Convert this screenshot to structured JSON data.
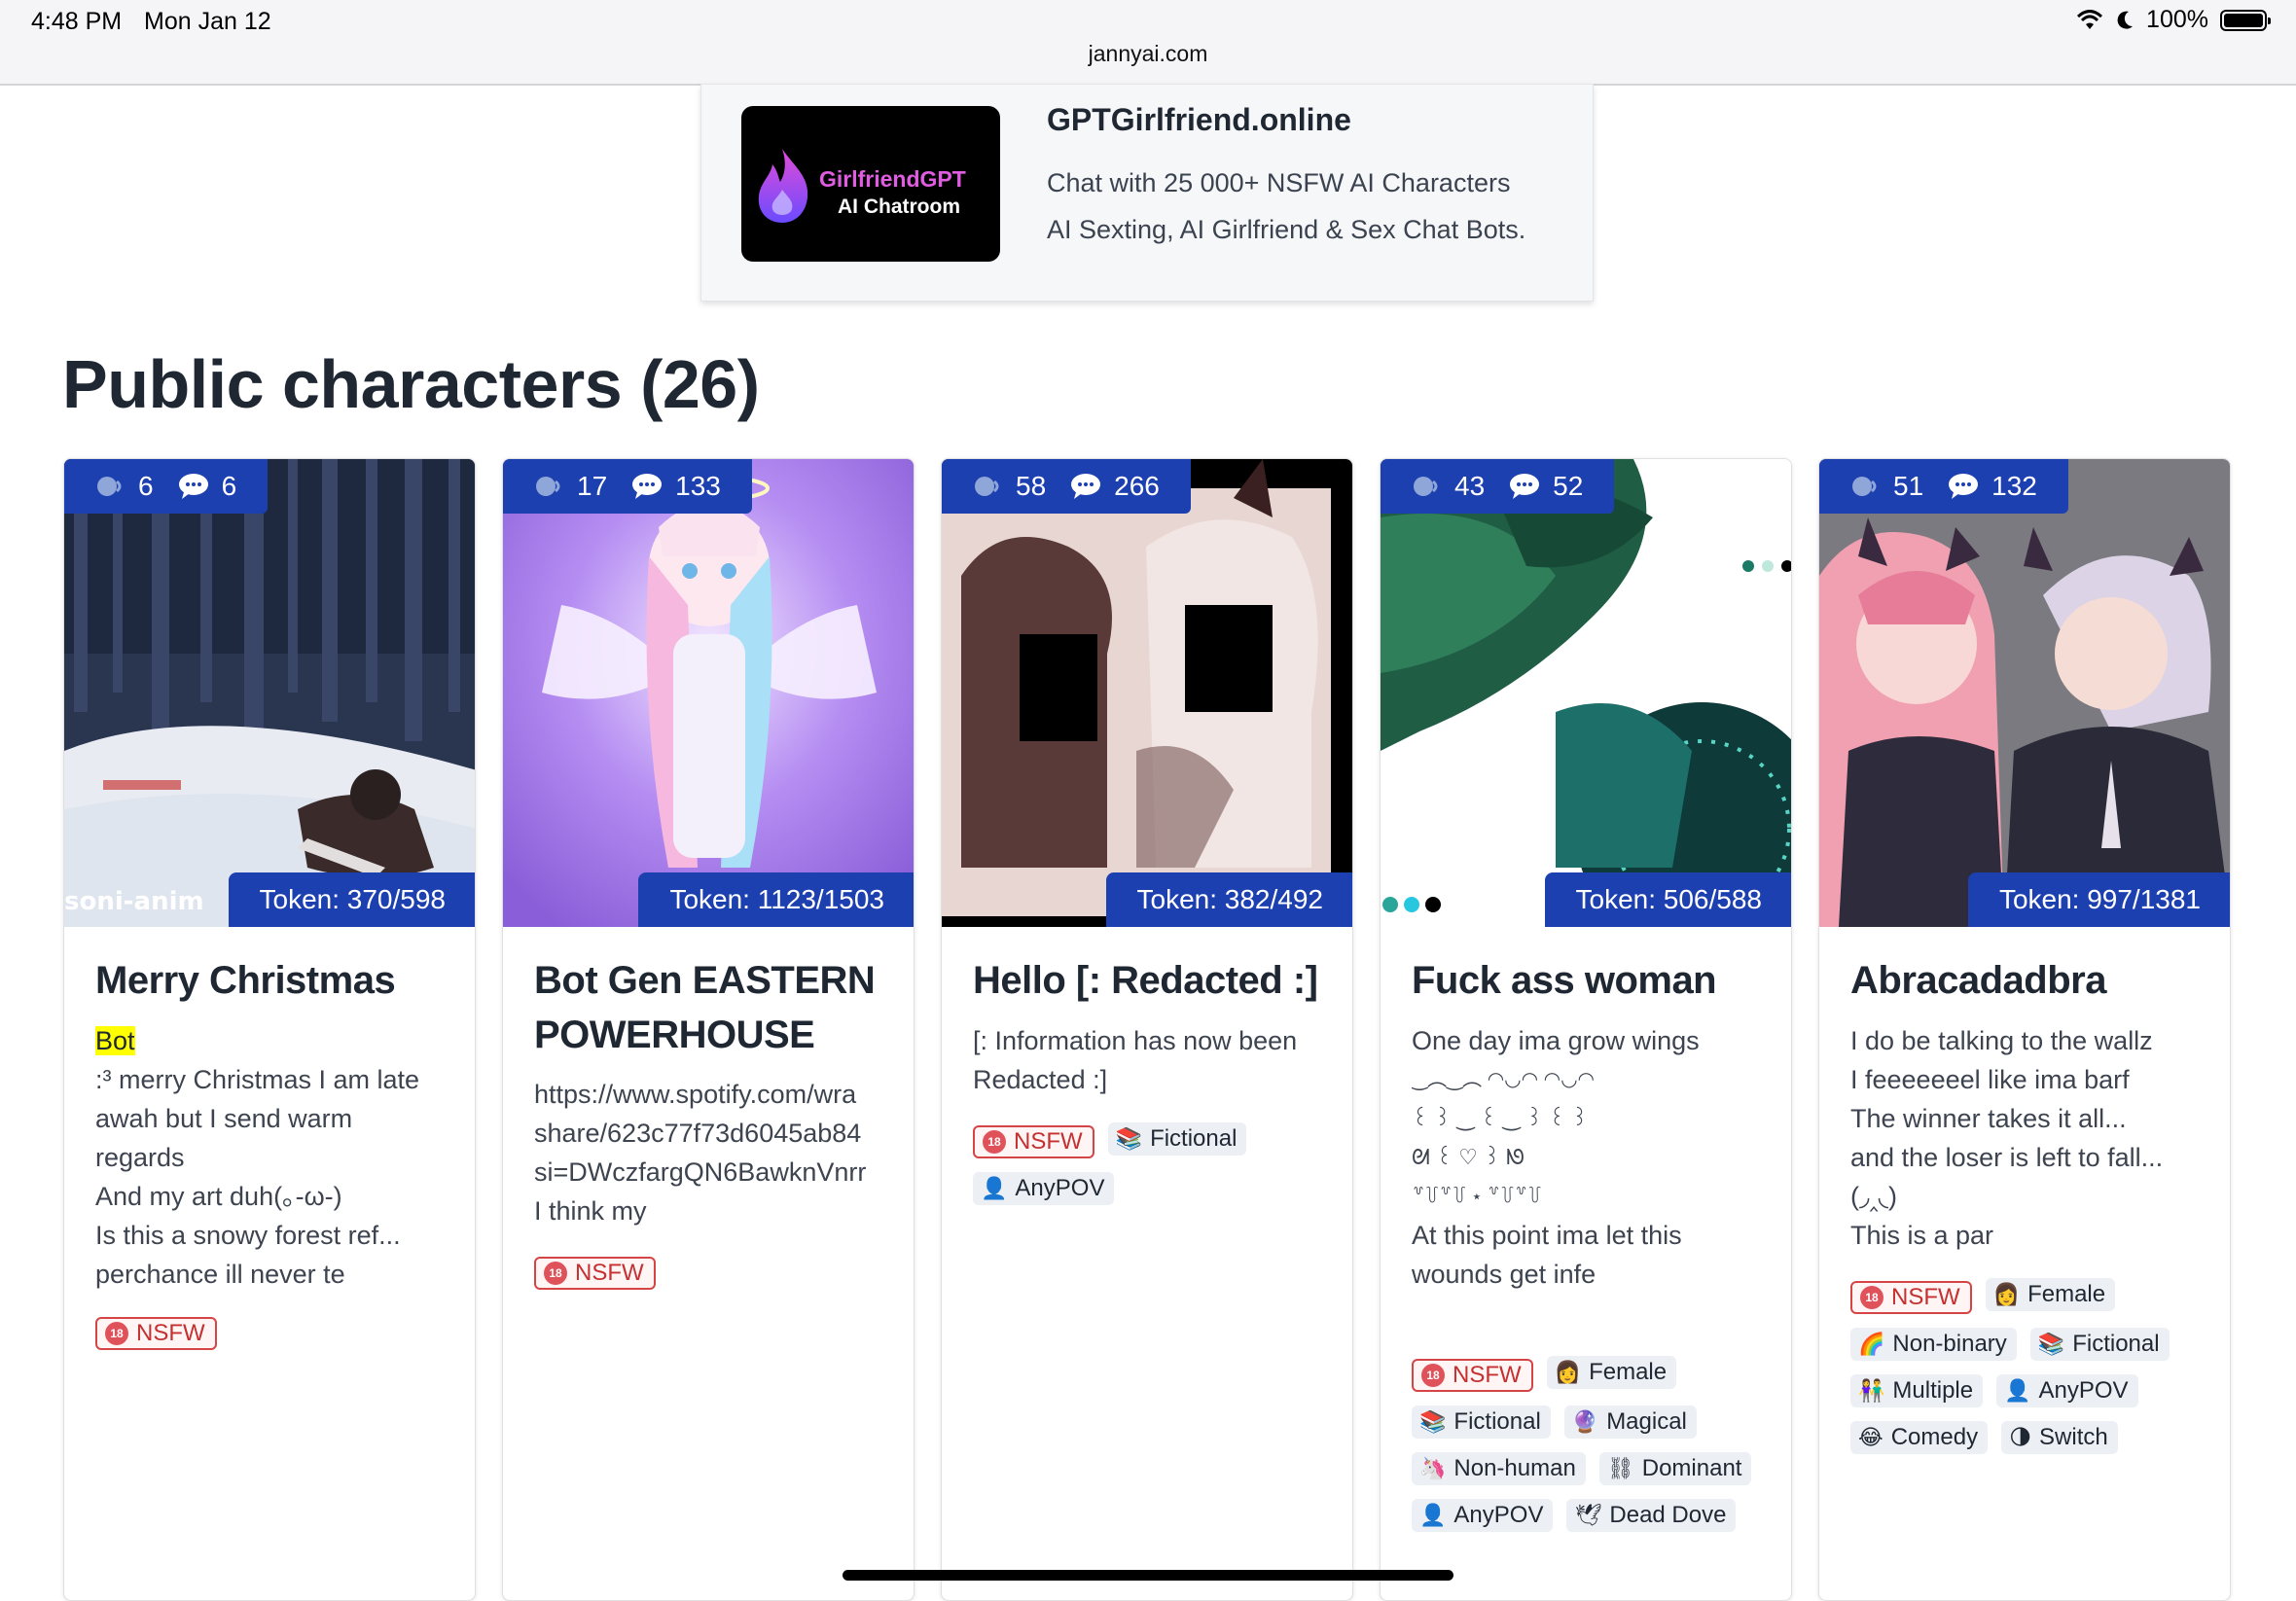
{
  "status_bar": {
    "time": "4:48 PM",
    "date": "Mon Jan 12",
    "url": "jannyai.com",
    "battery": "100%"
  },
  "ad": {
    "logo_line1": "GirlfriendGPT",
    "logo_line2": "AI Chatroom",
    "title": "GPTGirlfriend.online",
    "desc_line1": "Chat with 25 000+ NSFW AI Characters",
    "desc_line2": "AI Sexting, AI Girlfriend & Sex Chat Bots."
  },
  "page_title": "Public characters (26)",
  "icons": {
    "chats": "speech-head-icon",
    "messages": "speech-bubble-icon",
    "nsfw": "age-18-icon"
  },
  "colors": {
    "badge_blue": "#1d40b0",
    "nsfw_red": "#d64545",
    "highlight": "#ffff00"
  },
  "cards": [
    {
      "chats": "6",
      "messages": "6",
      "token": "Token: 370/598",
      "watermark": "soni-anim",
      "title": "Merry Christmas",
      "highlight": "Bot",
      "lines": [
        ":³ merry Christmas I am late",
        "awah but I send warm",
        "regards",
        "And my art duh(｡-ω-)",
        "Is this a snowy forest ref...",
        "perchance ill never te"
      ],
      "tags": [
        {
          "label": "NSFW",
          "icon": "🔞",
          "nsfw": true
        }
      ]
    },
    {
      "chats": "17",
      "messages": "133",
      "token": "Token: 1123/1503",
      "title_line1": "Bot Gen EASTERN",
      "title_line2": "POWERHOUSE",
      "lines": [
        "https://www.spotify.com/wra",
        "share/623c77f73d6045ab84",
        "si=DWczfargQN6BawknVnrr",
        "I think my"
      ],
      "tags": [
        {
          "label": "NSFW",
          "icon": "🔞",
          "nsfw": true
        }
      ]
    },
    {
      "chats": "58",
      "messages": "266",
      "token": "Token: 382/492",
      "title": "Hello [: Redacted :]",
      "lines": [
        "[: Information has now been",
        "Redacted :]"
      ],
      "tags": [
        {
          "label": "NSFW",
          "icon": "🔞",
          "nsfw": true
        },
        {
          "label": "Fictional",
          "icon": "📚"
        },
        {
          "label": "AnyPOV",
          "icon": "👤"
        }
      ]
    },
    {
      "chats": "43",
      "messages": "52",
      "token": "Token: 506/588",
      "title": "Fuck ass woman",
      "lines": [
        "One day ima grow wings",
        "‿︵‿︵ ◠◡◠ ◠◡◠",
        "꒰ ꒱ ‿ ꒰ ‿ ꒱ ꒰ ꒱",
        "ᘛ ꒰ ♡ ꒱ ᘚ",
        "꒷꒦꒷꒦ ⋆ ꒷꒦꒷꒦",
        "At this point ima let this",
        "wounds get infe"
      ],
      "tags": [
        {
          "label": "NSFW",
          "icon": "🔞",
          "nsfw": true
        },
        {
          "label": "Female",
          "icon": "👩"
        },
        {
          "label": "Fictional",
          "icon": "📚"
        },
        {
          "label": "Magical",
          "icon": "🔮"
        },
        {
          "label": "Non-human",
          "icon": "🦄"
        },
        {
          "label": "Dominant",
          "icon": "⛓"
        },
        {
          "label": "AnyPOV",
          "icon": "👤"
        },
        {
          "label": "Dead Dove",
          "icon": "🕊"
        }
      ]
    },
    {
      "chats": "51",
      "messages": "132",
      "token": "Token: 997/1381",
      "title": "Abracadadbra",
      "lines": [
        "I do be talking to the wallz",
        "I feeeeeeel like ima barf",
        "The winner takes it all...",
        "and the loser is left to fall...",
        "(◞‸◟)",
        "This is a par"
      ],
      "tags": [
        {
          "label": "NSFW",
          "icon": "🔞",
          "nsfw": true
        },
        {
          "label": "Female",
          "icon": "👩"
        },
        {
          "label": "Non-binary",
          "icon": "🌈"
        },
        {
          "label": "Fictional",
          "icon": "📚"
        },
        {
          "label": "Multiple",
          "icon": "👫"
        },
        {
          "label": "AnyPOV",
          "icon": "👤"
        },
        {
          "label": "Comedy",
          "icon": "😂"
        },
        {
          "label": "Switch",
          "icon": "🌗"
        }
      ]
    }
  ]
}
